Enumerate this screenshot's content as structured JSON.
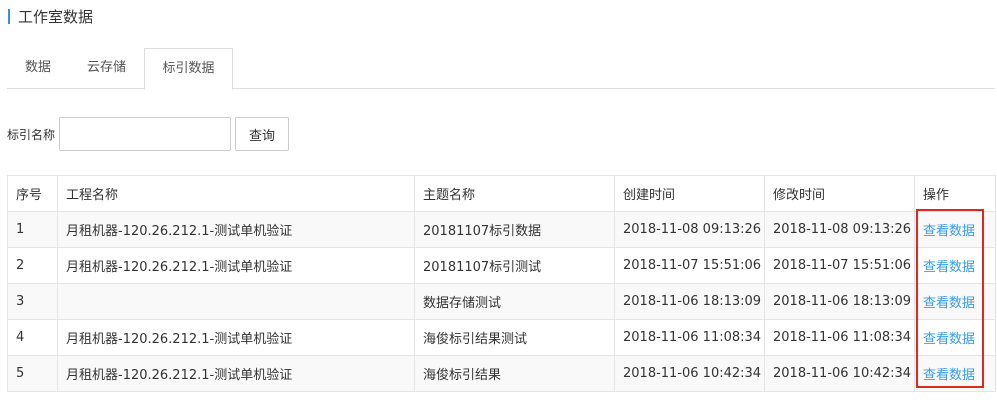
{
  "page": {
    "title": "工作室数据"
  },
  "tabs": [
    {
      "label": "数据"
    },
    {
      "label": "云存储"
    },
    {
      "label": "标引数据"
    }
  ],
  "search": {
    "label": "标引名称",
    "value": "",
    "button_label": "查询"
  },
  "table": {
    "headers": [
      "序号",
      "工程名称",
      "主题名称",
      "创建时间",
      "修改时间",
      "操作"
    ],
    "rows": [
      {
        "index": "1",
        "project": "月租机器-120.26.212.1-测试单机验证",
        "topic": "20181107标引数据",
        "created": "2018-11-08 09:13:26",
        "modified": "2018-11-08 09:13:26",
        "action": "查看数据"
      },
      {
        "index": "2",
        "project": "月租机器-120.26.212.1-测试单机验证",
        "topic": "20181107标引测试",
        "created": "2018-11-07 15:51:06",
        "modified": "2018-11-07 15:51:06",
        "action": "查看数据"
      },
      {
        "index": "3",
        "project": "",
        "topic": "数据存储测试",
        "created": "2018-11-06 18:13:09",
        "modified": "2018-11-06 18:13:09",
        "action": "查看数据"
      },
      {
        "index": "4",
        "project": "月租机器-120.26.212.1-测试单机验证",
        "topic": "海俊标引结果测试",
        "created": "2018-11-06 11:08:34",
        "modified": "2018-11-06 11:08:34",
        "action": "查看数据"
      },
      {
        "index": "5",
        "project": "月租机器-120.26.212.1-测试单机验证",
        "topic": "海俊标引结果",
        "created": "2018-11-06 10:42:34",
        "modified": "2018-11-06 10:42:34",
        "action": "查看数据"
      }
    ]
  },
  "colors": {
    "accent": "#3a8ee6",
    "link": "#3a9ee6",
    "highlight": "#e0281e"
  }
}
